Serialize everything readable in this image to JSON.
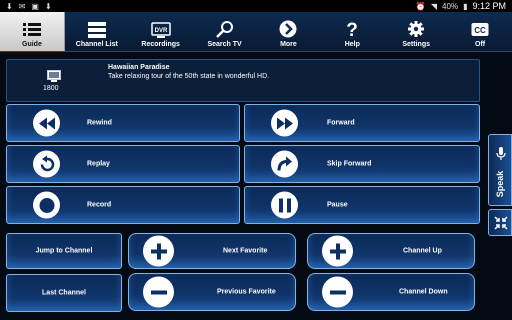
{
  "status_bar": {
    "battery": "40%",
    "time": "9:12 PM"
  },
  "nav": [
    {
      "label": "Guide",
      "icon": "guide-icon"
    },
    {
      "label": "Channel List",
      "icon": "channel-list-icon"
    },
    {
      "label": "Recordings",
      "icon": "dvr-icon",
      "badge": "DVR"
    },
    {
      "label": "Search TV",
      "icon": "search-icon"
    },
    {
      "label": "More",
      "icon": "more-arrow-icon"
    },
    {
      "label": "Help",
      "icon": "help-icon"
    },
    {
      "label": "Settings",
      "icon": "settings-gear-icon"
    },
    {
      "label": "Off",
      "icon": "cc-icon",
      "badge": "CC"
    }
  ],
  "program": {
    "channel": "1800",
    "title": "Hawaiian Paradise",
    "description": "Take relaxing tour of the 50th state in wonderful HD."
  },
  "controls": {
    "rewind": "Rewind",
    "forward": "Forward",
    "replay": "Replay",
    "skip_forward": "Skip Forward",
    "record": "Record",
    "pause": "Pause"
  },
  "channel_controls": {
    "jump": "Jump to Channel",
    "last": "Last Channel",
    "next_favorite": "Next Favorite",
    "previous_favorite": "Previous Favorite",
    "channel_up": "Channel Up",
    "channel_down": "Channel Down"
  },
  "side": {
    "speak": "Speak"
  },
  "colors": {
    "accent_border": "#7fb3e4",
    "nav_active": "#e6e6e6",
    "panel": "#0b1f3a"
  }
}
